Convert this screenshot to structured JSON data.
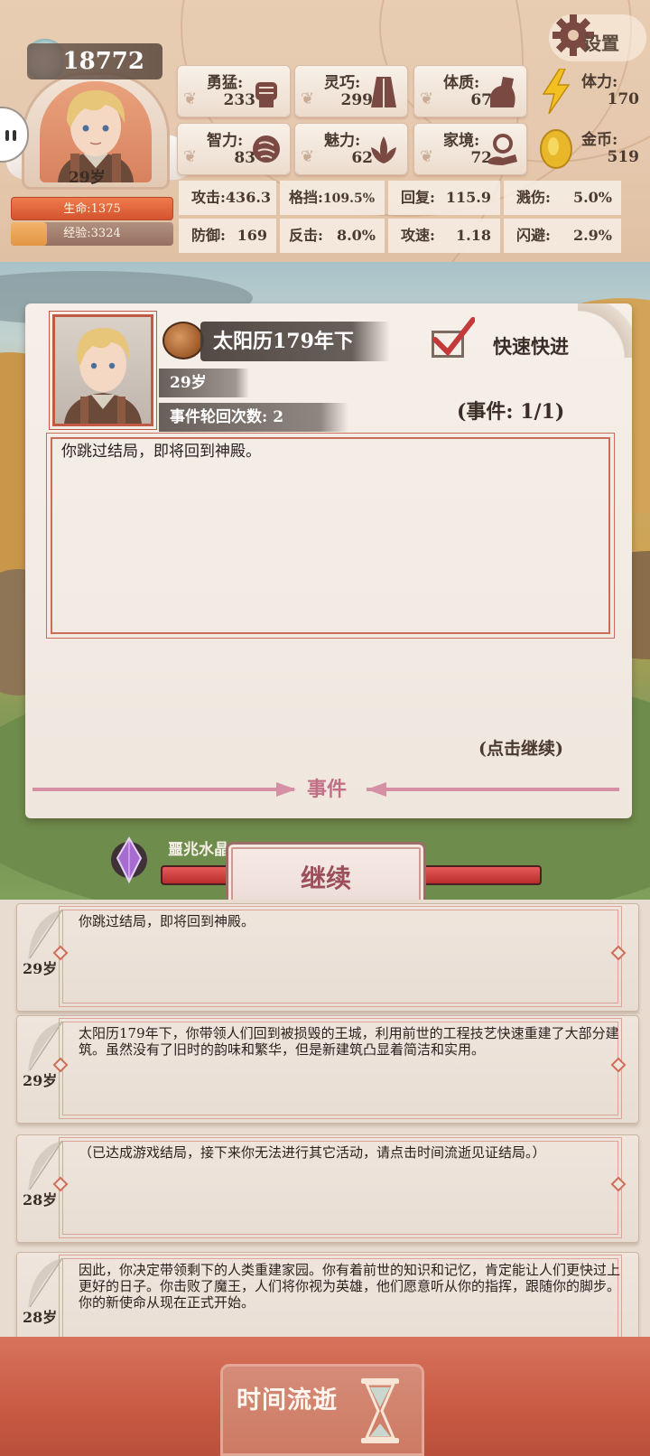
{
  "player": {
    "soul_points": "18772",
    "age": "29岁",
    "hp_label": "生命:1375",
    "hp_fill": 1.0,
    "xp_label": "经验:3324",
    "xp_fill": 0.22
  },
  "settings_label": "设置",
  "attributes": [
    {
      "label": "勇猛:",
      "value": "233",
      "icon": "fist-icon"
    },
    {
      "label": "灵巧:",
      "value": "299",
      "icon": "cloak-icon"
    },
    {
      "label": "体质:",
      "value": "67",
      "icon": "arm-icon"
    },
    {
      "label": "智力:",
      "value": "83",
      "icon": "brain-icon"
    },
    {
      "label": "魅力:",
      "value": "62",
      "icon": "lotus-icon"
    },
    {
      "label": "家境:",
      "value": "72",
      "icon": "house-hand-icon"
    }
  ],
  "resources": [
    {
      "label": "体力:",
      "value": "170",
      "icon": "lightning-icon"
    },
    {
      "label": "金币:",
      "value": "519",
      "icon": "gold-coin-icon"
    }
  ],
  "combat_stats": [
    {
      "label": "攻击:",
      "value": "436.3"
    },
    {
      "label": "格挡:",
      "value": "109.5%"
    },
    {
      "label": "回复:",
      "value": "115.9"
    },
    {
      "label": "溅伤:",
      "value": "5.0%"
    },
    {
      "label": "防御:",
      "value": "169"
    },
    {
      "label": "反击:",
      "value": "8.0%"
    },
    {
      "label": "攻速:",
      "value": "1.18"
    },
    {
      "label": "闪避:",
      "value": "2.9%"
    }
  ],
  "event": {
    "date": "太阳历179年下",
    "age": "29岁",
    "cycle_count": "事件轮回次数: 2",
    "quick_forward_label": "快速快进",
    "quick_forward_checked": true,
    "counter": "(事件: 1/1)",
    "text": "你跳过结局，即将回到神殿。",
    "click_continue": "(点击继续)",
    "title": "事件"
  },
  "crystal": {
    "label": "噩兆水晶",
    "level": 1.0
  },
  "continue_label": "继续",
  "log": [
    {
      "age": "29岁",
      "text": "你跳过结局，即将回到神殿。"
    },
    {
      "age": "29岁",
      "text": "太阳历179年下，你带领人们回到被损毁的王城，利用前世的工程技艺快速重建了大部分建筑。虽然没有了旧时的韵味和繁华，但是新建筑凸显着简洁和实用。"
    },
    {
      "age": "28岁",
      "text": "（已达成游戏结局，接下来你无法进行其它活动，请点击时间流逝见证结局。）"
    },
    {
      "age": "28岁",
      "text": "因此，你决定带领剩下的人类重建家园。你有着前世的知识和记忆，肯定能让人们更快过上更好的日子。你击败了魔王，人们将你视为英雄，他们愿意听从你的指挥，跟随你的脚步。你的新使命从现在正式开始。"
    }
  ],
  "time_pass_label": "时间流逝",
  "colors": {
    "accent_red": "#c95a44",
    "hp": "#e0603a",
    "xp": "#e8a050",
    "event_title": "#c26f86"
  }
}
